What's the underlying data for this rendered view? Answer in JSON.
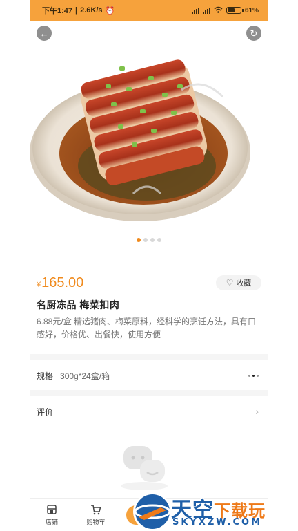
{
  "status": {
    "time": "下午1:47",
    "speed": "2.6K/s",
    "battery": "61%",
    "battery_level": 0.61
  },
  "product": {
    "currency": "¥",
    "price": "165.00",
    "favorite_label": "收藏",
    "title": "名厨冻品  梅菜扣肉",
    "description": "6.88元/盒  精选猪肉、梅菜原料，经科学的烹饪方法，具有口感好，价格优、出餐快，使用方便"
  },
  "carousel": {
    "total": 4,
    "active": 1
  },
  "spec": {
    "label": "规格",
    "value": "300g*24盒/箱"
  },
  "reviews": {
    "label": "评价"
  },
  "tabbar": {
    "shop": "店铺",
    "cart": "购物车"
  },
  "watermark": {
    "title_a": "天空",
    "title_b": "下载玩",
    "domain": "SKYXZW.COM"
  },
  "colors": {
    "accent": "#f6a23c",
    "price": "#f08a1c"
  }
}
